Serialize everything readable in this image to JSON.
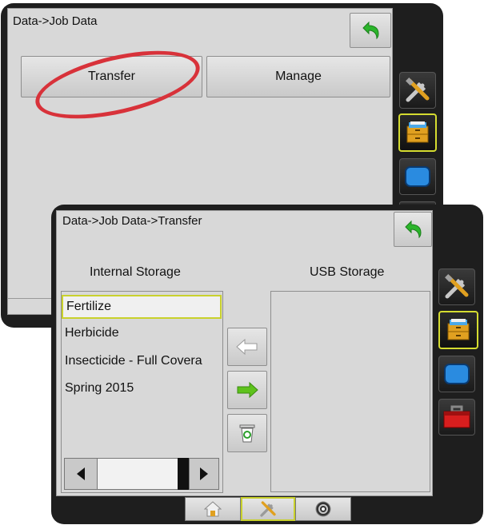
{
  "back_screen": {
    "title": "Data->Job Data",
    "tabs": {
      "transfer": "Transfer",
      "manage": "Manage"
    }
  },
  "front_screen": {
    "title": "Data->Job Data->Transfer",
    "internal_storage": {
      "header": "Internal Storage",
      "items": [
        "Fertilize",
        "Herbicide",
        "Insecticide - Full Covera",
        "Spring 2015"
      ],
      "selected_index": 0
    },
    "usb_storage": {
      "header": "USB Storage",
      "items": []
    }
  },
  "icons": {
    "back": "back-arrow-icon",
    "tools": "tools-icon",
    "data": "data-cabinet-icon",
    "display": "display-icon",
    "toolbox": "toolbox-icon",
    "home": "home-icon",
    "gps": "gps-icon",
    "copy_to_internal": "arrow-left-icon",
    "copy_to_usb": "arrow-right-icon",
    "delete": "recycle-bin-icon"
  },
  "colors": {
    "highlight": "#c9d12c",
    "annotation": "#d8323a",
    "back_arrow": "#2bb52b",
    "frame": "#1e1e1e"
  }
}
